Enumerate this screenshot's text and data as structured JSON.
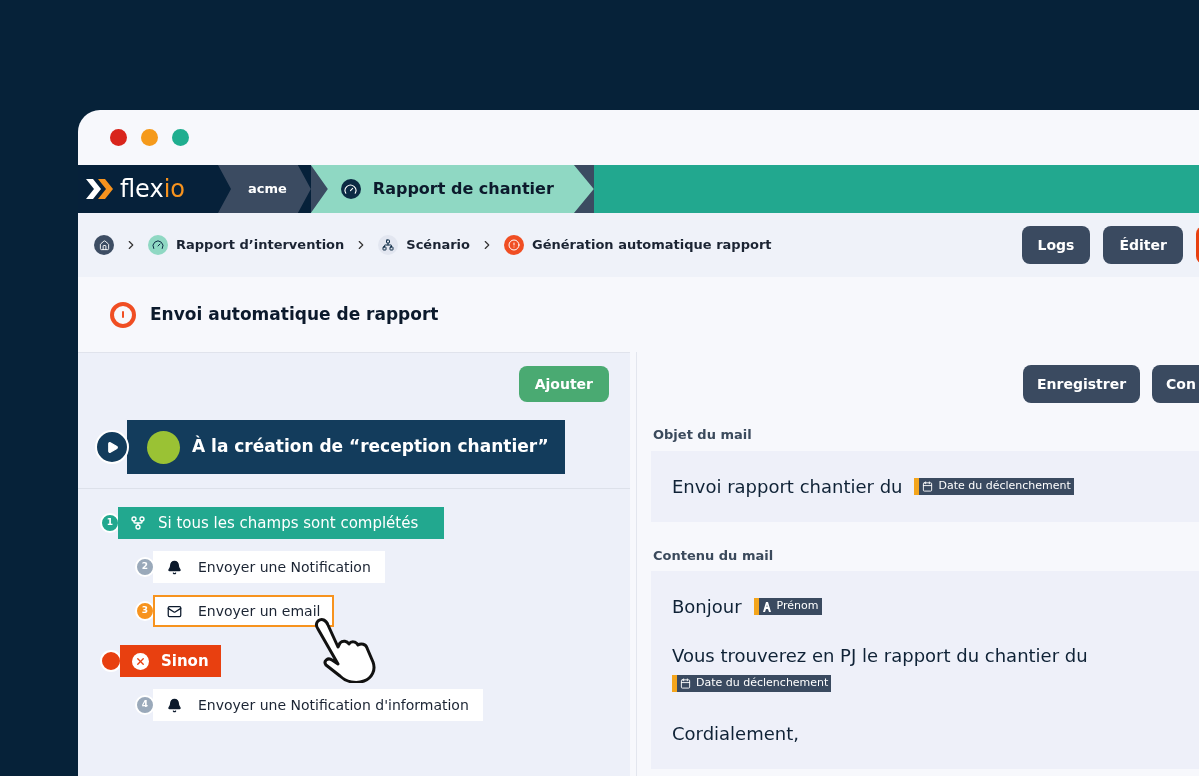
{
  "window": {
    "controls": [
      {
        "color": "#d9251c"
      },
      {
        "color": "#f59a1b"
      },
      {
        "color": "#1fae8f"
      }
    ]
  },
  "topbar": {
    "logo": {
      "text": "flex",
      "accent": "io"
    },
    "workspace": "acme",
    "app": "Rapport de chantier"
  },
  "breadcrumb": [
    {
      "kind": "home"
    },
    {
      "kind": "gauge",
      "label": "Rapport d’intervention"
    },
    {
      "kind": "tree",
      "label": "Scénario"
    },
    {
      "kind": "alert",
      "label": "Génération automatique rapport"
    }
  ],
  "toolbar_buttons": [
    {
      "kind": "dark",
      "label": "Logs"
    },
    {
      "kind": "dark",
      "label": "Éditer"
    },
    {
      "kind": "danger"
    }
  ],
  "page_title": "Envoi automatique de rapport",
  "left_panel": {
    "add_button": "Ajouter",
    "flow": [
      {
        "kind": "trigger",
        "label": "À la création de “reception chantier”"
      },
      {
        "kind": "condition",
        "number": "1",
        "label": "Si tous les champs sont complétés",
        "children": [
          {
            "kind": "notification",
            "number": "2",
            "label": "Envoyer une Notification",
            "selected": false
          },
          {
            "kind": "email",
            "number": "3",
            "label": "Envoyer un email",
            "selected": true
          }
        ]
      },
      {
        "kind": "else",
        "label": "Sinon",
        "children": [
          {
            "kind": "notification",
            "number": "4",
            "label": "Envoyer une Notification d'information",
            "selected": false
          }
        ]
      }
    ]
  },
  "right_panel": {
    "buttons": [
      "Enregistrer",
      "Con"
    ],
    "fields": [
      {
        "label": "Objet du mail",
        "lines": [
          [
            {
              "kind": "text",
              "text": "Envoi rapport chantier du"
            },
            {
              "kind": "date",
              "text": "Date du déclenchement"
            }
          ]
        ]
      },
      {
        "label": "Contenu du mail",
        "lines": [
          [
            {
              "kind": "text",
              "text": "Bonjour"
            },
            {
              "kind": "letter",
              "text": "Prénom"
            }
          ],
          [
            {
              "kind": "text",
              "text": "Vous trouverez en PJ le rapport du chantier du"
            }
          ],
          [
            {
              "kind": "date",
              "text": "Date du déclenchement"
            }
          ],
          [
            {
              "kind": "text",
              "text": "Cordialement,"
            }
          ]
        ]
      }
    ]
  }
}
